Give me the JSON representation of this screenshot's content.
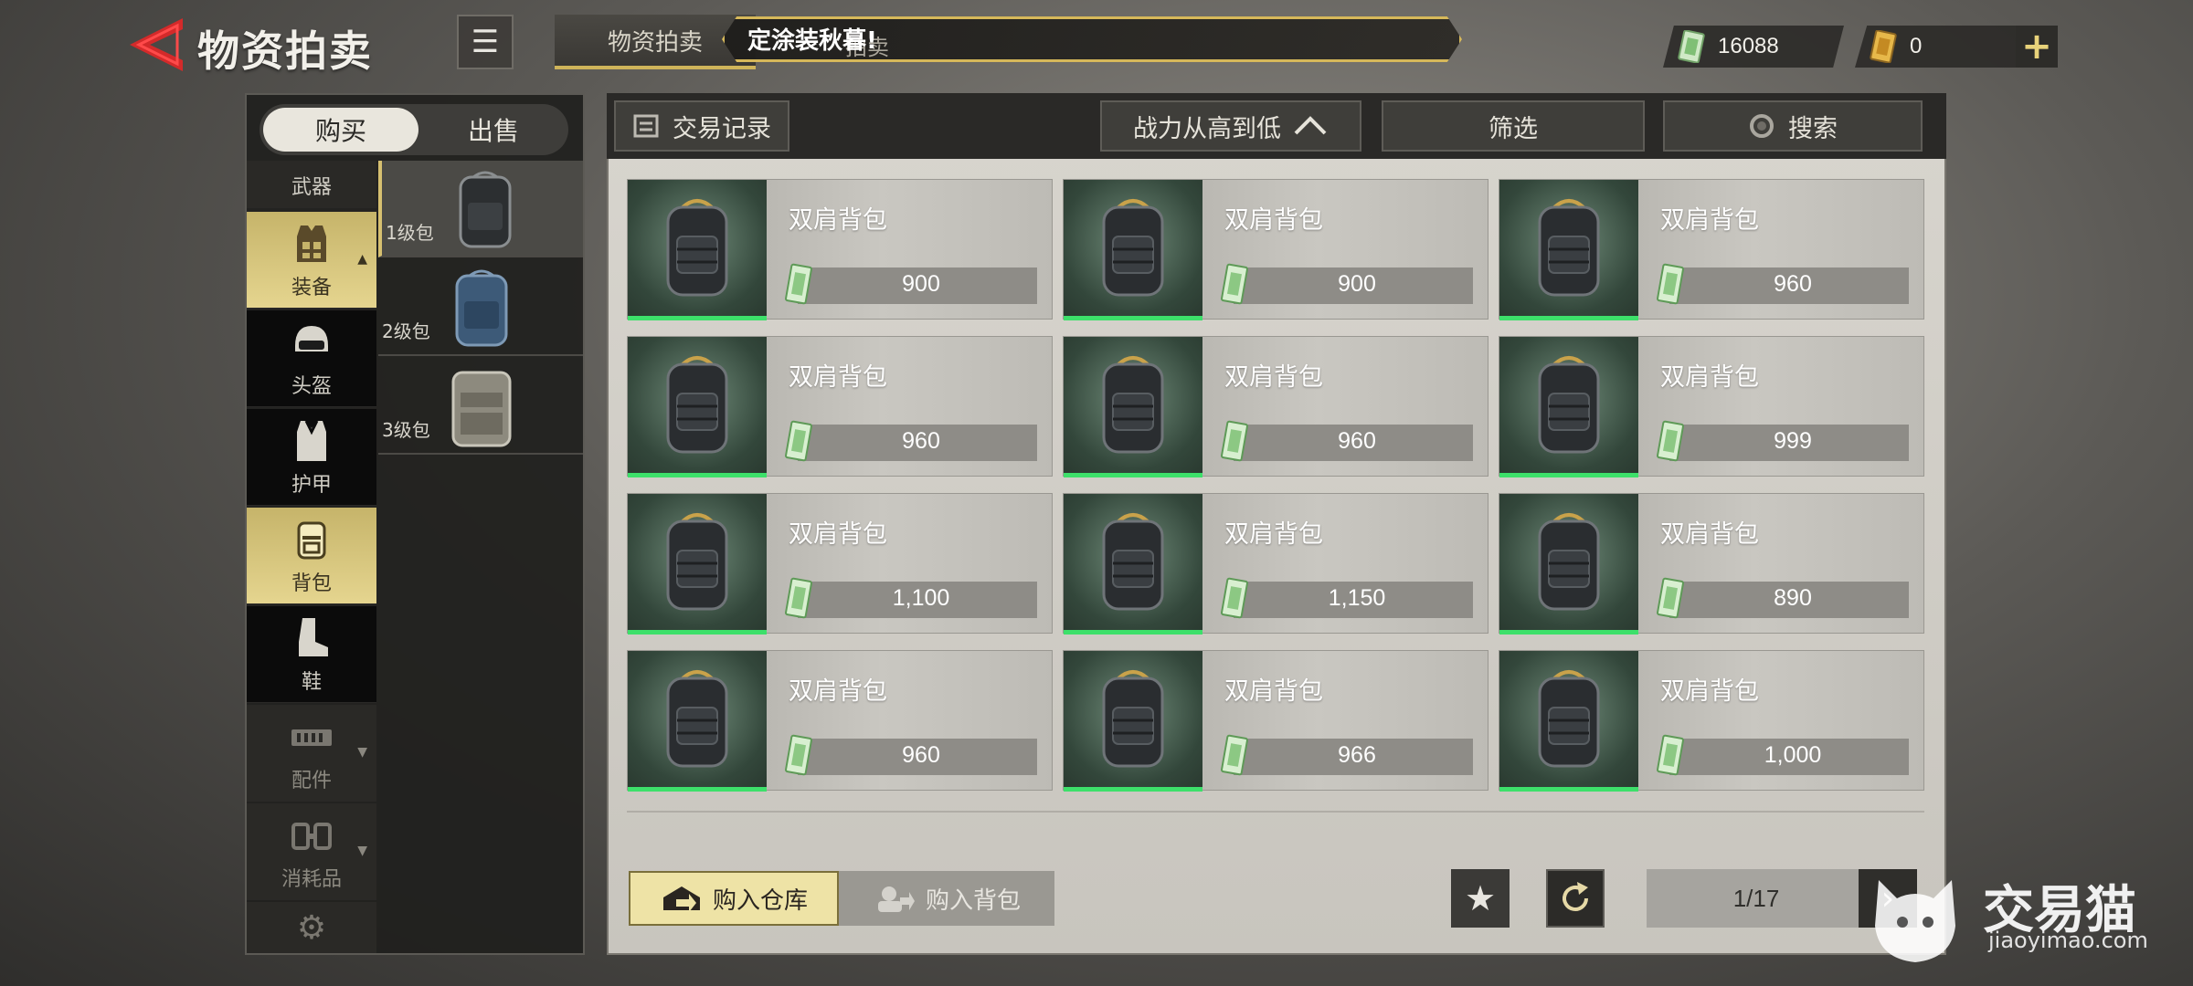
{
  "header": {
    "title": "物资拍卖",
    "menu_icon": "list-icon",
    "top_tab": "物资拍卖",
    "banner_text": "定涂装秋暮!",
    "banner_ghost_text": "拍卖"
  },
  "currency": {
    "cash_value": "16088",
    "ticket_value": "0",
    "add_label": "+"
  },
  "sidebar": {
    "toggle": {
      "buy": "购买",
      "sell": "出售"
    },
    "categories": [
      {
        "label": "武器",
        "icon": "gun-icon",
        "state": "normal"
      },
      {
        "label": "装备",
        "icon": "vest-icon",
        "state": "active"
      },
      {
        "label": "头盔",
        "icon": "helmet-icon",
        "state": "normal"
      },
      {
        "label": "护甲",
        "icon": "armor-icon",
        "state": "normal"
      },
      {
        "label": "背包",
        "icon": "backpack-icon",
        "state": "selected"
      },
      {
        "label": "鞋",
        "icon": "boot-icon",
        "state": "normal"
      },
      {
        "label": "配件",
        "icon": "magazine-icon",
        "state": "dim"
      },
      {
        "label": "消耗品",
        "icon": "consumable-icon",
        "state": "dim"
      }
    ],
    "subcategories": [
      {
        "label": "1级包"
      },
      {
        "label": "2级包"
      },
      {
        "label": "3级包"
      }
    ]
  },
  "toolbar": {
    "record": "交易记录",
    "sort": "战力从高到低",
    "filter": "筛选",
    "search": "搜索"
  },
  "items": [
    {
      "name": "双肩背包",
      "price": "900"
    },
    {
      "name": "双肩背包",
      "price": "900"
    },
    {
      "name": "双肩背包",
      "price": "960"
    },
    {
      "name": "双肩背包",
      "price": "960"
    },
    {
      "name": "双肩背包",
      "price": "960"
    },
    {
      "name": "双肩背包",
      "price": "999"
    },
    {
      "name": "双肩背包",
      "price": "1,100"
    },
    {
      "name": "双肩背包",
      "price": "1,150"
    },
    {
      "name": "双肩背包",
      "price": "890"
    },
    {
      "name": "双肩背包",
      "price": "960"
    },
    {
      "name": "双肩背包",
      "price": "966"
    },
    {
      "name": "双肩背包",
      "price": "1,000"
    }
  ],
  "footer": {
    "buy_warehouse": "购入仓库",
    "buy_backpack": "购入背包",
    "page": "1/17"
  },
  "watermark": {
    "name": "交易猫",
    "url": "jiaoyimao.com"
  },
  "colors": {
    "accent_gold": "#d6b85a",
    "rarity_green": "#3de06a"
  }
}
